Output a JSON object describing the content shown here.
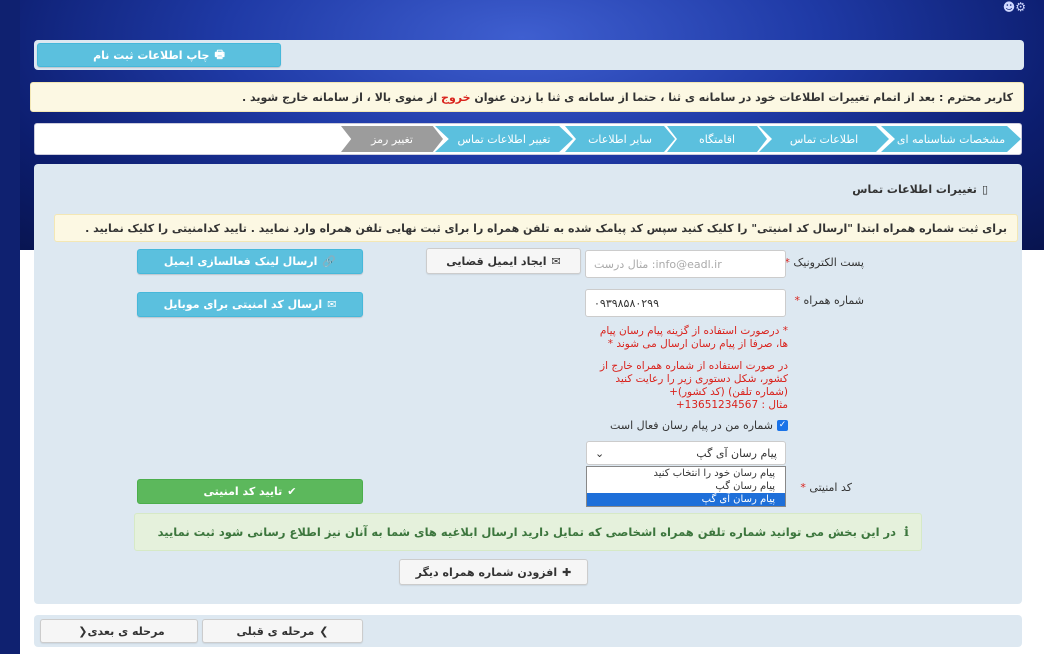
{
  "colors": {
    "info": "#5bc0de",
    "success": "#5cb85c",
    "warning_bg": "#fcf8e3",
    "danger_text": "#d9231d",
    "banner": "#1f3aa6"
  },
  "header": {
    "user_icon": "user-icon"
  },
  "print_button": {
    "label": "چاپ اطلاعات ثبت نام",
    "icon": "print-icon"
  },
  "notice": {
    "before": "کاربر محترم : بعد از اتمام تغییرات اطلاعات خود در سامانه ی ثنا ، حتما از سامانه ی ثنا با زدن عنوان ",
    "exit_word": "خروج",
    "after": " از منوی بالا ، از سامانه خارج شوید ."
  },
  "steps": [
    {
      "label": "مشخصات شناسنامه ای",
      "state": "done"
    },
    {
      "label": "اطلاعات تماس",
      "state": "done"
    },
    {
      "label": "اقامتگاه",
      "state": "done"
    },
    {
      "label": "سایر اطلاعات",
      "state": "done"
    },
    {
      "label": "تغییر اطلاعات تماس",
      "state": "done"
    },
    {
      "label": "تغییر رمز",
      "state": "active"
    }
  ],
  "section": {
    "title": "تغییرات اطلاعات تماس",
    "icon": "mobile-icon"
  },
  "instruction": "برای ثبت شماره همراه ابتدا \"ارسال کد امنیتی\" را کلیک کنید سپس کد پیامک شده به تلفن همراه را برای ثبت نهایی تلفن همراه وارد نمایید . تایید کدامنیتی را کلیک نمایید .",
  "form": {
    "email_label": "پست الکترونیک",
    "email_placeholder": "مثال درست :info@eadl.ir",
    "create_email_button": "ایجاد ایمیل قضایی",
    "send_email_link_button": "ارسال لینک فعالسازی ایمیل",
    "mobile_label": "شماره همراه",
    "mobile_value": "۰۹۳۹۸۵۸۰۲۹۹",
    "send_code_button": "ارسال کد امنیتی برای موبایل",
    "note1": "* درصورت استفاده از گزینه پیام رسان پیام ها، صرفا از پیام رسان ارسال می شوند *",
    "note2_line1": "در صورت استفاده از شماره همراه خارج از",
    "note2_line2": "کشور، شکل دستوری زیر را رعایت کنید",
    "note2_line3": "(شماره تلفن) (کد کشور)+",
    "note2_line4": "مثال : 13651234567+",
    "messenger_checkbox_label": "شماره من در پیام رسان فعال است",
    "messenger_checked": true,
    "messenger_selected": "پیام رسان آی گپ",
    "messenger_options": [
      "پیام رسان خود را انتخاب کنید",
      "پیام رسان گپ",
      "پیام رسان آی گپ"
    ],
    "security_code_label": "کد امنیتی",
    "confirm_code_button": "تایید کد امنیتی"
  },
  "info_alert": "در این بخش می توانید شماره تلفن همراه اشخاصی که تمایل دارید ارسال ابلاغیه های شما به آنان نیز اطلاع رسانی شود ثبت نمایید",
  "add_mobile_button": "افزودن شماره همراه دیگر",
  "nav": {
    "prev": "مرحله ی قبلی",
    "next": "مرحله ی بعدی"
  }
}
